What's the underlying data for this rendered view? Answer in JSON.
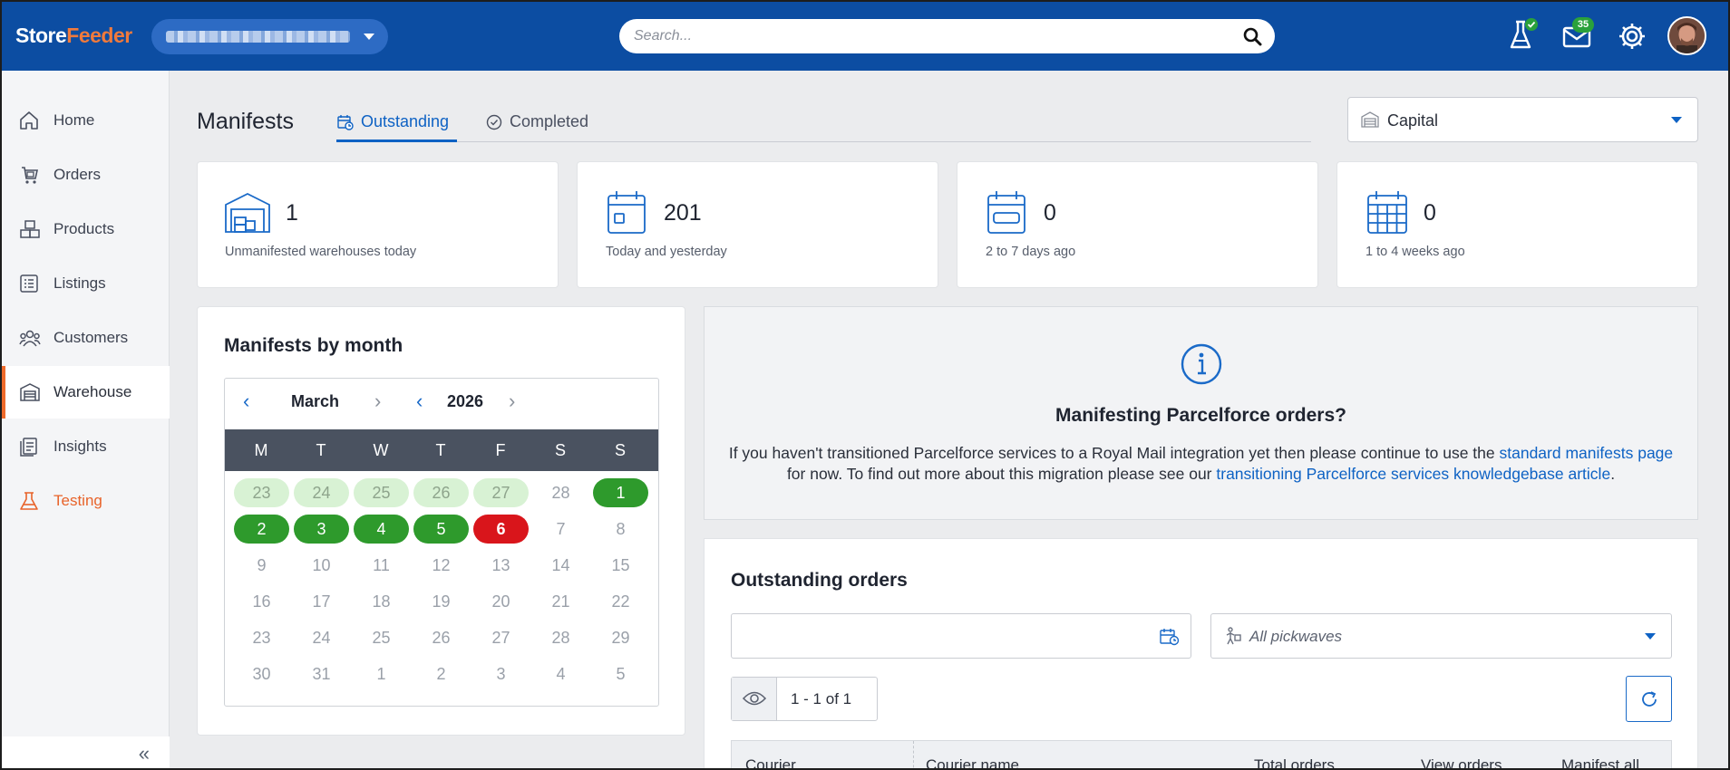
{
  "brand": {
    "part1": "Store",
    "part2": "Feeder"
  },
  "topbar": {
    "search_placeholder": "Search...",
    "mail_badge": "35",
    "icons": [
      "lab-flask-icon",
      "mail-icon",
      "gear-icon",
      "avatar"
    ]
  },
  "sidebar": {
    "items": [
      {
        "label": "Home",
        "icon": "home-icon"
      },
      {
        "label": "Orders",
        "icon": "orders-icon"
      },
      {
        "label": "Products",
        "icon": "products-icon"
      },
      {
        "label": "Listings",
        "icon": "listings-icon"
      },
      {
        "label": "Customers",
        "icon": "customers-icon"
      },
      {
        "label": "Warehouse",
        "icon": "warehouse-icon",
        "active": true
      },
      {
        "label": "Insights",
        "icon": "insights-icon"
      },
      {
        "label": "Testing",
        "icon": "flask-icon"
      }
    ],
    "collapse_label": "«"
  },
  "page": {
    "title": "Manifests",
    "tabs": [
      {
        "label": "Outstanding",
        "active": true
      },
      {
        "label": "Completed",
        "active": false
      }
    ],
    "warehouse_select": "Capital"
  },
  "stats": [
    {
      "value": "1",
      "caption": "Unmanifested warehouses today",
      "icon": "warehouse-icon"
    },
    {
      "value": "201",
      "caption": "Today and yesterday",
      "icon": "calendar-day-icon"
    },
    {
      "value": "0",
      "caption": "2 to 7 days ago",
      "icon": "calendar-week-icon"
    },
    {
      "value": "0",
      "caption": "1 to 4 weeks ago",
      "icon": "calendar-month-icon"
    }
  ],
  "calendar": {
    "title": "Manifests by month",
    "month": "March",
    "year": "2026",
    "weekdays": [
      "M",
      "T",
      "W",
      "T",
      "F",
      "S",
      "S"
    ],
    "weeks": [
      [
        "23",
        "24",
        "25",
        "26",
        "27",
        "28",
        "1"
      ],
      [
        "2",
        "3",
        "4",
        "5",
        "6",
        "7",
        "8"
      ],
      [
        "9",
        "10",
        "11",
        "12",
        "13",
        "14",
        "15"
      ],
      [
        "16",
        "17",
        "18",
        "19",
        "20",
        "21",
        "22"
      ],
      [
        "23",
        "24",
        "25",
        "26",
        "27",
        "28",
        "29"
      ],
      [
        "30",
        "31",
        "1",
        "2",
        "3",
        "4",
        "5"
      ]
    ],
    "states": [
      [
        "past",
        "past",
        "past",
        "past",
        "past",
        "",
        "done"
      ],
      [
        "done",
        "done",
        "done",
        "done",
        "today",
        "",
        ""
      ],
      [
        "",
        "",
        "",
        "",
        "",
        "",
        ""
      ],
      [
        "",
        "",
        "",
        "",
        "",
        "",
        ""
      ],
      [
        "",
        "",
        "",
        "",
        "",
        "",
        ""
      ],
      [
        "",
        "",
        "",
        "",
        "",
        "",
        ""
      ]
    ],
    "colors": {
      "done": "#2e9a2c",
      "today": "#d9151b",
      "past": "#d8f2d4"
    }
  },
  "info": {
    "title": "Manifesting Parcelforce orders?",
    "text_1": "If you haven't transitioned Parcelforce services to a Royal Mail integration yet then please continue to use the ",
    "link_1": "standard manifests page",
    "text_2": " for now. To find out more about this migration please see our ",
    "link_2": "transitioning Parcelforce services knowledgebase article",
    "text_3": "."
  },
  "orders": {
    "title": "Outstanding orders",
    "date_value": "",
    "pickwave_placeholder": "All pickwaves",
    "pager_label": "1 - 1 of 1",
    "columns": [
      "Courier",
      "Courier name",
      "Total orders",
      "View orders",
      "Manifest all"
    ]
  },
  "colors": {
    "brand_blue": "#0c4da2",
    "accent_orange": "#ee6a2a",
    "link_blue": "#0e62c4"
  }
}
